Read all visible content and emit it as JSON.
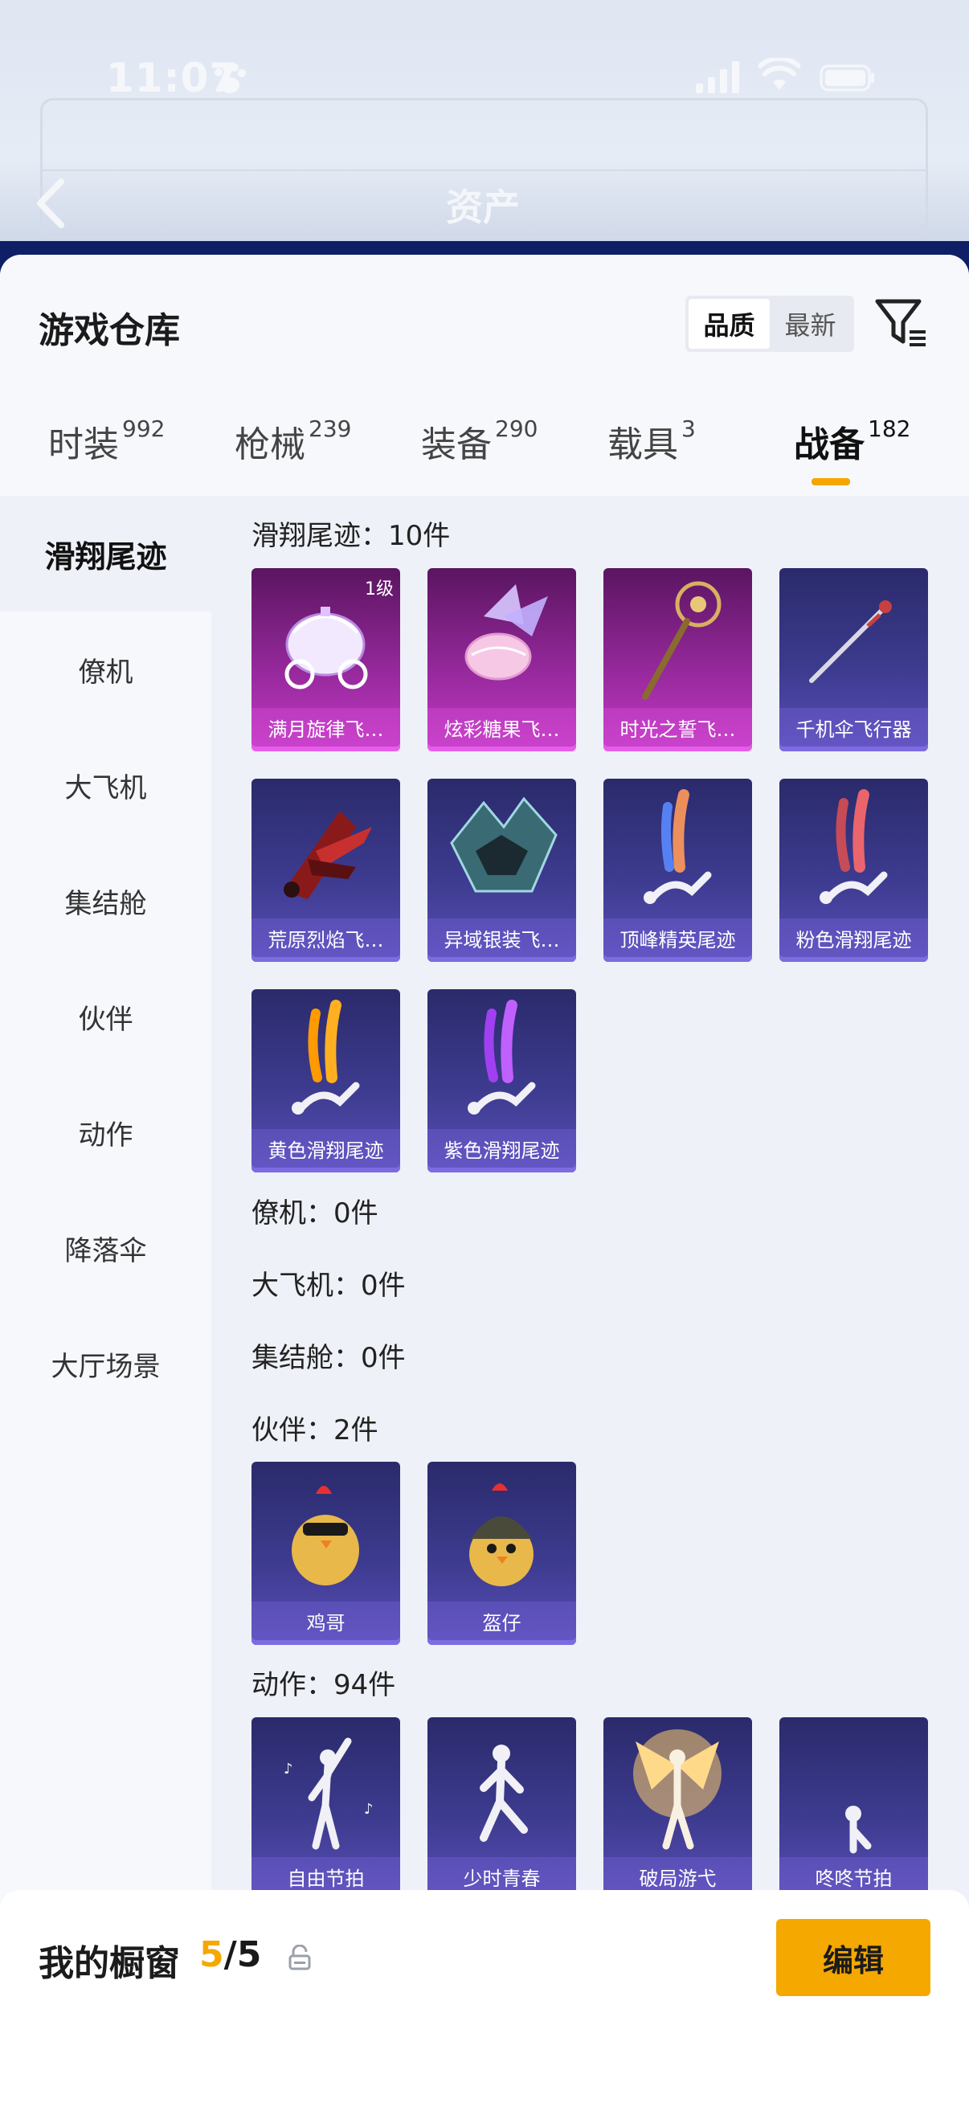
{
  "status_bar": {
    "time": "11:07"
  },
  "header": {
    "title": "资产"
  },
  "warehouse": {
    "title": "游戏仓库",
    "sort_options": [
      "品质",
      "最新"
    ],
    "active_sort": "品质"
  },
  "tabs": [
    {
      "label": "时装",
      "count": "992"
    },
    {
      "label": "枪械",
      "count": "239"
    },
    {
      "label": "装备",
      "count": "290"
    },
    {
      "label": "载具",
      "count": "3"
    },
    {
      "label": "战备",
      "count": "182",
      "active": true
    }
  ],
  "sidebar": {
    "items": [
      {
        "label": "滑翔尾迹",
        "active": true
      },
      {
        "label": "僚机"
      },
      {
        "label": "大飞机"
      },
      {
        "label": "集结舱"
      },
      {
        "label": "伙伴"
      },
      {
        "label": "动作"
      },
      {
        "label": "降落伞"
      },
      {
        "label": "大厅场景"
      }
    ]
  },
  "sections": [
    {
      "title": "滑翔尾迹：10件",
      "items": [
        {
          "name": "满月旋律飞…",
          "rarity": "pink",
          "level": "1级",
          "icon": "carriage-icon"
        },
        {
          "name": "炫彩糖果飞…",
          "rarity": "pink",
          "icon": "candy-icon"
        },
        {
          "name": "时光之誓飞…",
          "rarity": "pink",
          "icon": "scepter-icon"
        },
        {
          "name": "千机伞飞行器",
          "rarity": "purple",
          "icon": "umbrella-icon"
        },
        {
          "name": "荒原烈焰飞…",
          "rarity": "purple",
          "icon": "flame-glider-icon"
        },
        {
          "name": "异域银装飞…",
          "rarity": "purple",
          "icon": "silver-glider-icon"
        },
        {
          "name": "顶峰精英尾迹",
          "rarity": "purple",
          "icon": "trail-icon"
        },
        {
          "name": "粉色滑翔尾迹",
          "rarity": "purple",
          "icon": "trail-icon"
        },
        {
          "name": "黄色滑翔尾迹",
          "rarity": "purple",
          "icon": "trail-icon"
        },
        {
          "name": "紫色滑翔尾迹",
          "rarity": "purple",
          "icon": "trail-icon"
        }
      ]
    },
    {
      "title": "僚机：0件",
      "items": []
    },
    {
      "title": "大飞机：0件",
      "items": []
    },
    {
      "title": "集结舱：0件",
      "items": []
    },
    {
      "title": "伙伴：2件",
      "items": [
        {
          "name": "鸡哥",
          "rarity": "purple",
          "icon": "chicken-icon"
        },
        {
          "name": "盔仔",
          "rarity": "purple",
          "icon": "helmet-chick-icon"
        }
      ]
    },
    {
      "title": "动作：94件",
      "items": [
        {
          "name": "自由节拍",
          "rarity": "purple",
          "icon": "dance-icon"
        },
        {
          "name": "少时青春",
          "rarity": "purple",
          "icon": "dance-icon"
        },
        {
          "name": "破局游弋",
          "rarity": "purple",
          "icon": "golden-wings-icon"
        },
        {
          "name": "咚咚节拍",
          "rarity": "purple",
          "icon": "dance-icon"
        }
      ]
    }
  ],
  "showcase": {
    "label": "我的橱窗",
    "current": "5",
    "total": "/5",
    "edit_label": "编辑"
  },
  "colors": {
    "accent": "#f5a800",
    "card_purple": "#3d3b8f",
    "card_pink": "#9a2aa0"
  }
}
